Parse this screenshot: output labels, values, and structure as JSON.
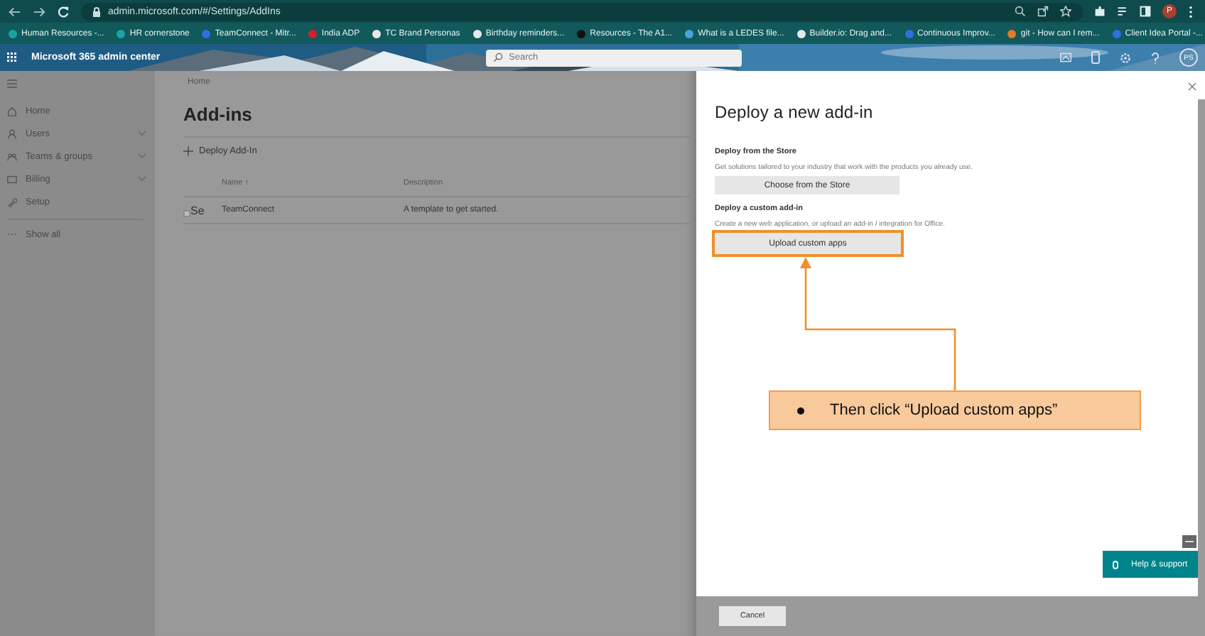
{
  "browser": {
    "url": "admin.microsoft.com/#/Settings/AddIns",
    "profile_initial": "P",
    "bookmarks": [
      {
        "label": "Human Resources -...",
        "color": "#1ba1a8"
      },
      {
        "label": "HR cornerstone",
        "color": "#1ba1a8"
      },
      {
        "label": "TeamConnect - Mitr...",
        "color": "#2f6fe0"
      },
      {
        "label": "India ADP",
        "color": "#d4202a"
      },
      {
        "label": "TC Brand Personas",
        "color": "#e8e8e8"
      },
      {
        "label": "Birthday reminders...",
        "color": "#e8e8e8"
      },
      {
        "label": "Resources - The A1...",
        "color": "#111111"
      },
      {
        "label": "What is a LEDES file...",
        "color": "#4aa3df"
      },
      {
        "label": "Builder.io: Drag and...",
        "color": "#e8e8e8"
      },
      {
        "label": "Continuous Improv...",
        "color": "#2f6fe0"
      },
      {
        "label": "git - How can I rem...",
        "color": "#e07b2a"
      },
      {
        "label": "Client Idea Portal -...",
        "color": "#2f6fe0"
      }
    ]
  },
  "app_header": {
    "title": "Microsoft 365 admin center",
    "search": {
      "placeholder": "Search"
    },
    "avatar": "PS"
  },
  "sidebar": {
    "items": [
      {
        "label": "Home",
        "expandable": false,
        "kind": "home"
      },
      {
        "label": "Users",
        "expandable": true,
        "kind": "user"
      },
      {
        "label": "Teams & groups",
        "expandable": true,
        "kind": "group"
      },
      {
        "label": "Billing",
        "expandable": true,
        "kind": "card"
      },
      {
        "label": "Setup",
        "expandable": false,
        "kind": "wrench"
      }
    ],
    "show_all": "Show all"
  },
  "main": {
    "breadcrumb": "Home",
    "title": "Add-ins",
    "deploy_button": "Deploy Add-In",
    "table": {
      "columns": [
        "Name ↑",
        "Description"
      ],
      "rows": [
        {
          "image_alt": "Se",
          "name": "TeamConnect",
          "description": "A template to get started."
        }
      ]
    }
  },
  "panel": {
    "title": "Deploy a new add-in",
    "sections": [
      {
        "heading": "Deploy from the Store",
        "description": "Get solutions tailored to your industry that work with the products you already use.",
        "button": "Choose from the Store",
        "highlighted": false
      },
      {
        "heading": "Deploy a custom add-in",
        "description": "Create a new web application, or upload an add-in / integration for Office.",
        "button": "Upload custom apps",
        "highlighted": true
      }
    ],
    "cancel": "Cancel"
  },
  "callout": {
    "text": "Then click “Upload custom apps”"
  },
  "help_button": "Help & support"
}
